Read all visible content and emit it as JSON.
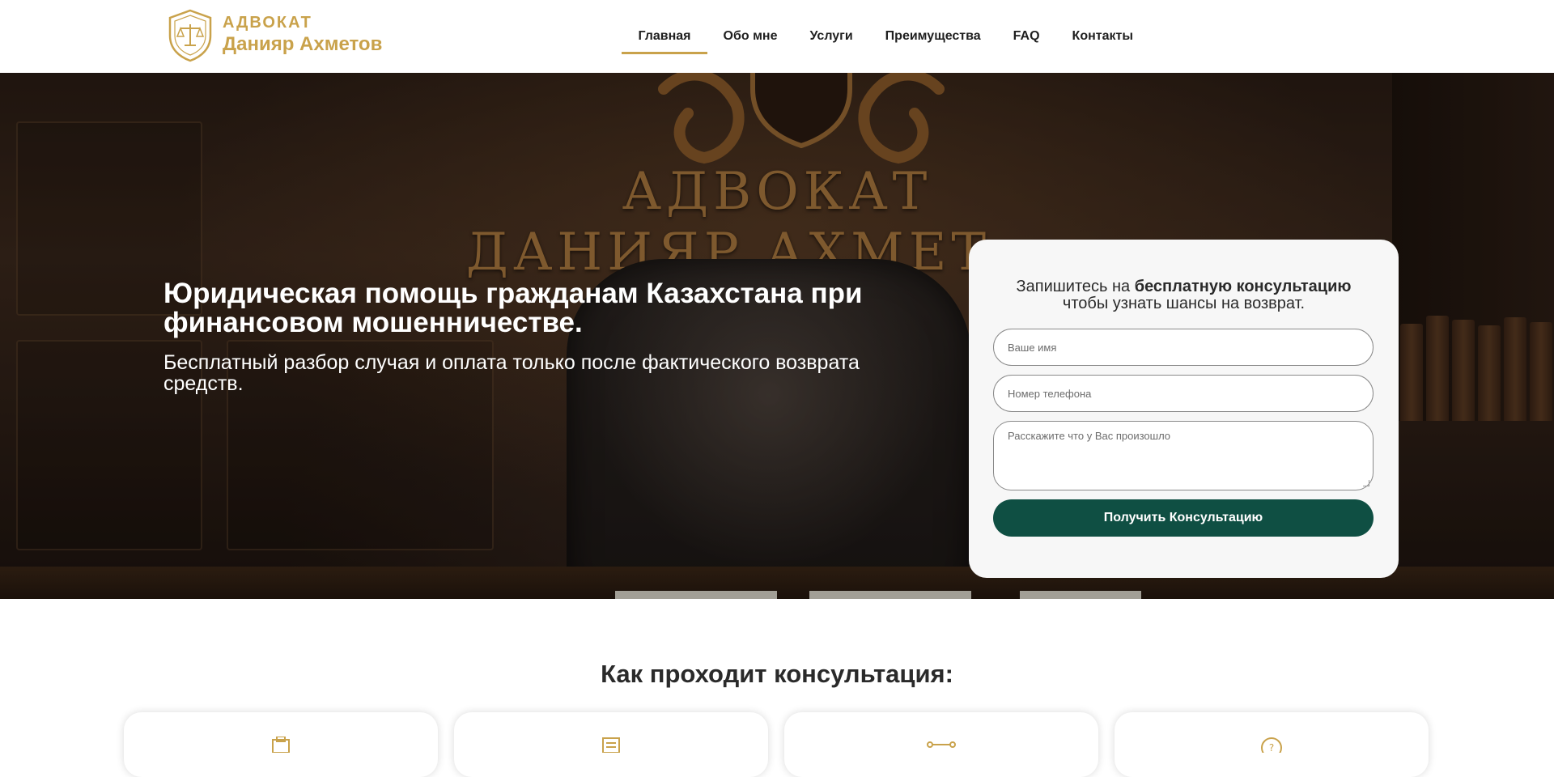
{
  "brand": {
    "line1": "АДВОКАТ",
    "line2": "Данияр Ахметов",
    "accent_color": "#c9a24b"
  },
  "nav": {
    "items": [
      {
        "label": "Главная",
        "active": true
      },
      {
        "label": "Обо мне",
        "active": false
      },
      {
        "label": "Услуги",
        "active": false
      },
      {
        "label": "Преимущества",
        "active": false
      },
      {
        "label": "FAQ",
        "active": false
      },
      {
        "label": "Контакты",
        "active": false
      }
    ]
  },
  "hero": {
    "wall_line1": "АДВОКАТ",
    "wall_line2": "ДАНИЯР АХМЕТ",
    "title": "Юридическая помощь гражданам Казахстана при финансовом мошенничестве.",
    "subtitle": "Бесплатный разбор случая и оплата только после фактического возврата средств."
  },
  "form": {
    "heading_prefix": "Запишитесь на ",
    "heading_bold": "бесплатную консультацию",
    "heading_suffix": "чтобы узнать шансы на возврат.",
    "name_placeholder": "Ваше имя",
    "phone_placeholder": "Номер телефона",
    "message_placeholder": "Расскажите что у Вас произошло",
    "submit_label": "Получить Консультацию",
    "button_color": "#0f4f43"
  },
  "consultation": {
    "title": "Как проходит консультация:",
    "steps": [
      {
        "icon": "clipboard-icon"
      },
      {
        "icon": "document-icon"
      },
      {
        "icon": "route-icon"
      },
      {
        "icon": "question-icon"
      }
    ]
  }
}
